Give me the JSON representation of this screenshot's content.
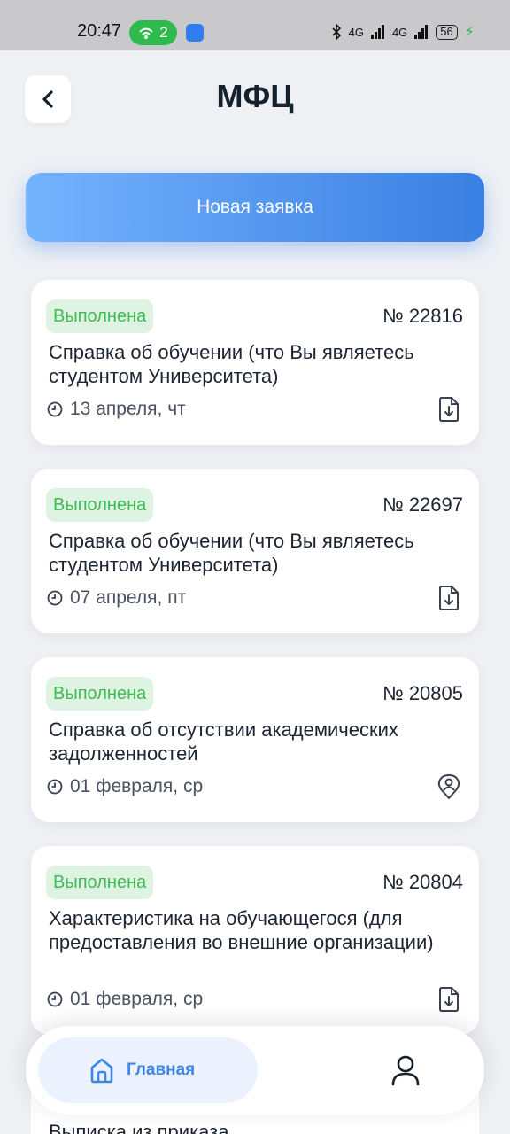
{
  "status_bar": {
    "time": "20:47",
    "hotspot_count": "2",
    "network_1": "4G",
    "network_2": "4G",
    "battery": "56"
  },
  "header": {
    "title": "МФЦ"
  },
  "actions": {
    "new_request_label": "Новая заявка"
  },
  "requests": [
    {
      "status": "Выполнена",
      "number": "№ 22816",
      "title": "Справка об обучении (что Вы являетесь студентом Университета)",
      "date": "13 апреля, чт",
      "action_icon": "file-download-icon"
    },
    {
      "status": "Выполнена",
      "number": "№ 22697",
      "title": "Справка об обучении (что Вы являетесь студентом Университета)",
      "date": "07 апреля, пт",
      "action_icon": "file-download-icon"
    },
    {
      "status": "Выполнена",
      "number": "№ 20805",
      "title": "Справка об отсутствии академических задолженностей",
      "date": "01 февраля, ср",
      "action_icon": "location-person-icon"
    },
    {
      "status": "Выполнена",
      "number": "№ 20804",
      "title": "Характеристика на обучающегося (для предоставления во внешние организации)",
      "date": "01 февраля, ср",
      "action_icon": "file-download-icon"
    },
    {
      "title": "Выписка из приказа"
    }
  ],
  "bottom_nav": {
    "home_label": "Главная",
    "home_icon": "home-icon",
    "profile_icon": "user-icon"
  },
  "colors": {
    "accent": "#3d86e8",
    "status_done_text": "#3dbb54",
    "status_done_bg": "#dff3e3",
    "background": "#eef0f4"
  }
}
